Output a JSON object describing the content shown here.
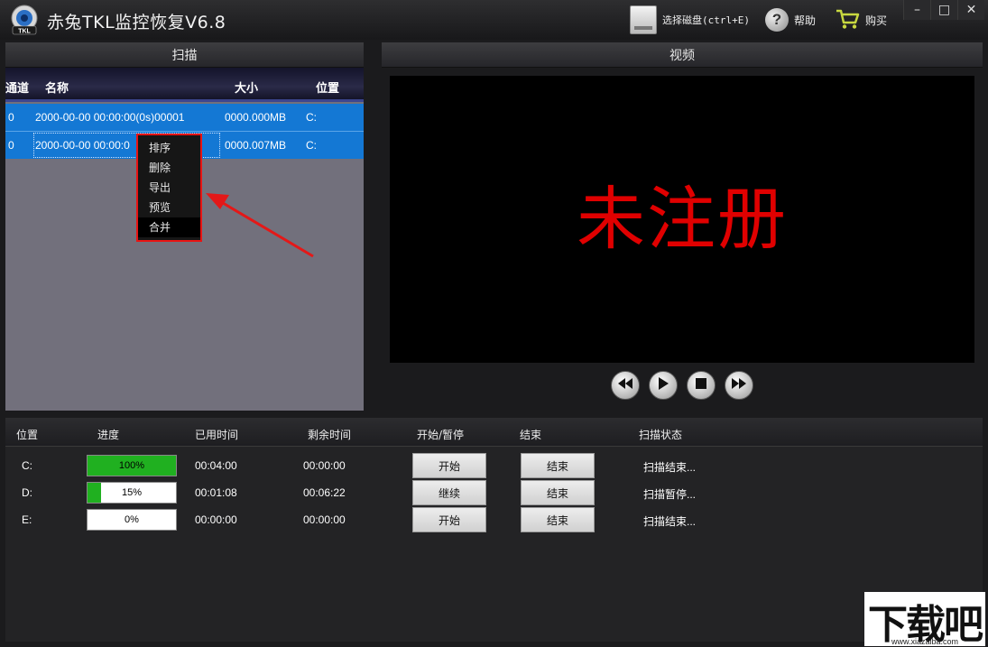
{
  "app": {
    "title": "赤兔TKL监控恢复V6.8",
    "logo_text": "TKL"
  },
  "toolbar": {
    "select_disk": "选择磁盘(ctrl+E)",
    "help": "帮助",
    "buy": "购买"
  },
  "window_controls": {
    "minimize": "–",
    "maximize": "□",
    "close": "✕"
  },
  "scan_panel": {
    "title": "扫描",
    "columns": {
      "channel": "通道",
      "name": "名称",
      "size": "大小",
      "location": "位置"
    },
    "rows": [
      {
        "channel": "0",
        "name": "2000-00-00 00:00:00(0s)00001",
        "size": "0000.000MB",
        "location": "C:"
      },
      {
        "channel": "0",
        "name": "2000-00-00 00:00:0",
        "size": "0000.007MB",
        "location": "C:"
      }
    ]
  },
  "context_menu": {
    "items": [
      "排序",
      "删除",
      "导出",
      "预览",
      "合并"
    ],
    "active": "合并"
  },
  "video_panel": {
    "title": "视频",
    "overlay_text": "未注册"
  },
  "playback": {
    "rewind_icon": "rewind-icon",
    "play_icon": "play-icon",
    "stop_icon": "stop-icon",
    "forward_icon": "fast-forward-icon"
  },
  "scan_status": {
    "columns": {
      "location": "位置",
      "progress": "进度",
      "elapsed": "已用时间",
      "remaining": "剩余时间",
      "start_pause": "开始/暂停",
      "end": "结束",
      "status": "扫描状态"
    },
    "rows": [
      {
        "location": "C:",
        "progress": 100,
        "progress_label": "100%",
        "elapsed": "00:04:00",
        "remaining": "00:00:00",
        "action": "开始",
        "end": "结束",
        "status": "扫描结束..."
      },
      {
        "location": "D:",
        "progress": 15,
        "progress_label": "15%",
        "elapsed": "00:01:08",
        "remaining": "00:06:22",
        "action": "继续",
        "end": "结束",
        "status": "扫描暂停..."
      },
      {
        "location": "E:",
        "progress": 0,
        "progress_label": "0%",
        "elapsed": "00:00:00",
        "remaining": "00:00:00",
        "action": "开始",
        "end": "结束",
        "status": "扫描结束..."
      }
    ]
  },
  "watermark": {
    "main": "下载吧",
    "sub": "www.xiazaiba.com"
  }
}
